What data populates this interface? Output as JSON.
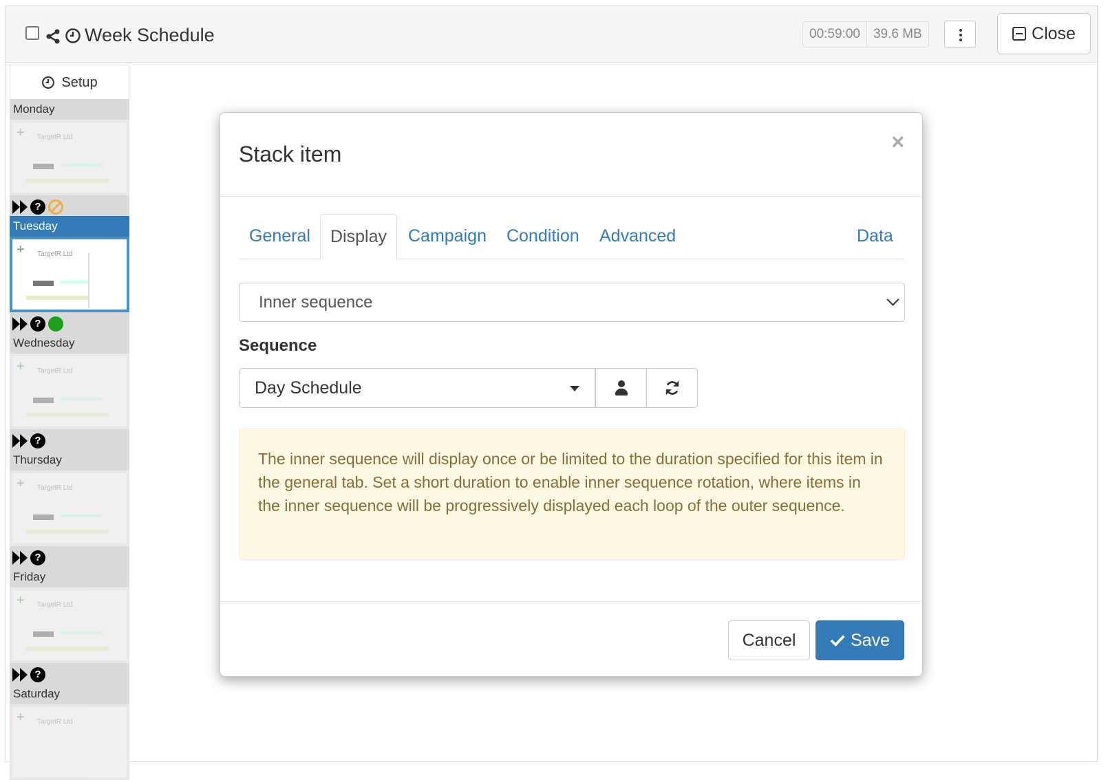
{
  "header": {
    "title": "Week Schedule",
    "duration": "00:59:00",
    "size": "39.6 MB",
    "close_label": "Close"
  },
  "sidebar": {
    "setup_label": "Setup",
    "thumb_brand": "TargetR Ltd",
    "days": [
      {
        "label": "Monday",
        "status": [
          "fast-forward-icon",
          "question-icon",
          "ban-icon"
        ]
      },
      {
        "label": "Tuesday",
        "status": [
          "fast-forward-icon",
          "question-icon",
          "active-dot-icon"
        ],
        "selected": true
      },
      {
        "label": "Wednesday",
        "status": [
          "fast-forward-icon",
          "question-icon"
        ]
      },
      {
        "label": "Thursday",
        "status": [
          "fast-forward-icon",
          "question-icon"
        ]
      },
      {
        "label": "Friday",
        "status": [
          "fast-forward-icon",
          "question-icon"
        ]
      },
      {
        "label": "Saturday",
        "status": []
      }
    ]
  },
  "modal": {
    "title": "Stack item",
    "close_symbol": "×",
    "tabs": [
      "General",
      "Display",
      "Campaign",
      "Condition",
      "Advanced",
      "Data"
    ],
    "active_tab": "Display",
    "display_mode": "Inner sequence",
    "sequence_label": "Sequence",
    "sequence_value": "Day Schedule",
    "alert_text": "The inner sequence will display once or be limited to the duration specified for this item in the general tab. Set a short duration to enable inner sequence rotation, where items in the inner sequence will be progressively displayed each loop of the outer sequence.",
    "cancel_label": "Cancel",
    "save_label": "Save"
  },
  "colors": {
    "primary": "#337ab7",
    "warning_bg": "#fcf8e3",
    "warning_text": "#8a6d3b",
    "status_green": "#1f9d1f",
    "status_orange": "#f0ad4e"
  }
}
